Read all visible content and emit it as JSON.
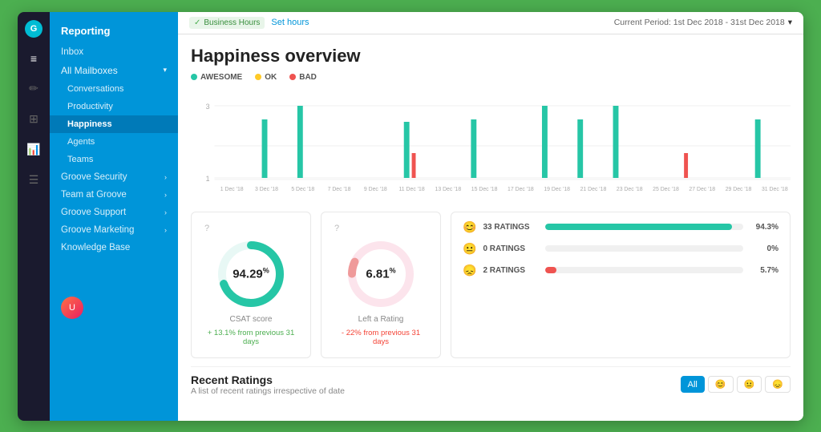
{
  "app": {
    "logo": "G",
    "background_color": "#4caf50"
  },
  "topbar": {
    "business_hours_label": "Business Hours",
    "set_hours_label": "Set hours",
    "period_label": "Current Period: 1st Dec 2018 - 31st Dec 2018"
  },
  "sidebar": {
    "title": "Reporting",
    "items": [
      {
        "label": "Inbox",
        "level": 0,
        "active": false
      },
      {
        "label": "All Mailboxes",
        "level": 0,
        "active": false,
        "has_chevron": true
      },
      {
        "label": "Conversations",
        "level": 1,
        "active": false
      },
      {
        "label": "Productivity",
        "level": 1,
        "active": false
      },
      {
        "label": "Happiness",
        "level": 1,
        "active": true
      },
      {
        "label": "Agents",
        "level": 1,
        "active": false
      },
      {
        "label": "Teams",
        "level": 1,
        "active": false
      },
      {
        "label": "Groove Security",
        "level": 0,
        "active": false,
        "has_chevron": true
      },
      {
        "label": "Team at Groove",
        "level": 0,
        "active": false,
        "has_chevron": true
      },
      {
        "label": "Groove Support",
        "level": 0,
        "active": false,
        "has_chevron": true
      },
      {
        "label": "Groove Marketing",
        "level": 0,
        "active": false,
        "has_chevron": true
      },
      {
        "label": "Knowledge Base",
        "level": 0,
        "active": false
      }
    ]
  },
  "page": {
    "title": "Happiness overview",
    "legend": [
      {
        "label": "AWESOME",
        "color": "#26c6a6"
      },
      {
        "label": "OK",
        "color": "#ffca28"
      },
      {
        "label": "BAD",
        "color": "#ef5350"
      }
    ]
  },
  "chart": {
    "y_labels": [
      "3",
      "",
      "1"
    ],
    "x_labels": [
      "1 Dec '18",
      "3 Dec '18",
      "5 Dec '18",
      "7 Dec '18",
      "9 Dec '18",
      "11 Dec '18",
      "13 Dec '18",
      "15 Dec '18",
      "17 Dec '18",
      "19 Dec '18",
      "21 Dec '18",
      "23 Dec '18",
      "25 Dec '18",
      "27 Dec '18",
      "29 Dec '18",
      "31 Dec '18"
    ],
    "bars_awesome": [
      0,
      2.5,
      3,
      0,
      0,
      2,
      0,
      2.5,
      0,
      3,
      2.5,
      3,
      0,
      0,
      0,
      2
    ],
    "bars_ok": [
      0,
      0,
      0,
      0,
      0,
      0,
      0,
      0,
      0,
      0,
      0,
      0,
      0,
      0,
      0,
      0
    ],
    "bars_bad": [
      0,
      0,
      0,
      0,
      0,
      1,
      0,
      0,
      0,
      0,
      0,
      0,
      0,
      1,
      0,
      0
    ]
  },
  "stats": {
    "csat": {
      "value": "94.29",
      "unit": "%",
      "label": "CSAT score",
      "trend": "+ 13.1% from previous 31 days",
      "trend_positive": true,
      "donut_color": "#26c6a6",
      "donut_pct": 94.29
    },
    "left_rating": {
      "value": "6.81",
      "unit": "%",
      "label": "Left a Rating",
      "trend": "- 22% from previous 31 days",
      "trend_positive": false,
      "donut_color": "#ef9a9a",
      "donut_pct": 6.81
    }
  },
  "ratings": [
    {
      "emoji": "😊",
      "label": "33 RATINGS",
      "color": "#26c6a6",
      "pct": 94.3,
      "pct_label": "94.3%"
    },
    {
      "emoji": "😐",
      "label": "0 RATINGS",
      "color": "#ffca28",
      "pct": 0,
      "pct_label": "0%"
    },
    {
      "emoji": "😞",
      "label": "2 RATINGS",
      "color": "#ef5350",
      "pct": 5.7,
      "pct_label": "5.7%"
    }
  ],
  "recent": {
    "title": "Recent Ratings",
    "subtitle": "A list of recent ratings irrespective of date",
    "filters": [
      {
        "label": "All",
        "active": true
      },
      {
        "emoji": "😊",
        "active": false
      },
      {
        "emoji": "😐",
        "active": false
      },
      {
        "emoji": "😞",
        "active": false
      }
    ]
  },
  "icons": {
    "hamburger": "≡",
    "pencil": "✏",
    "grid": "⊞",
    "chart": "⚡",
    "list": "☰",
    "check": "✓",
    "chevron_right": "›",
    "chevron_down": "▾"
  }
}
